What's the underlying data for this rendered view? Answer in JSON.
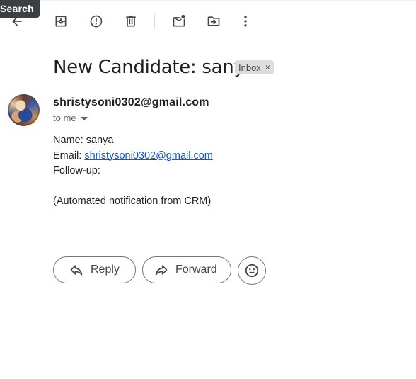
{
  "tooltip": {
    "text": "Search"
  },
  "toolbar": {
    "back_icon": "arrow-left-icon",
    "archive_icon": "archive-icon",
    "spam_icon": "report-spam-icon",
    "delete_icon": "trash-icon",
    "mark_unread_icon": "mark-unread-icon",
    "move_icon": "move-to-folder-icon",
    "more_icon": "more-vert-icon"
  },
  "email": {
    "subject": "New Candidate: sanya",
    "label": "Inbox",
    "label_close": "×",
    "sender": "shristysoni0302@gmail.com",
    "recipient": "to me",
    "body": {
      "name_line": "Name: sanya",
      "email_prefix": "Email: ",
      "email_link": "shristysoni0302@gmail.com",
      "followup_line": "Follow-up:",
      "blank_line": "",
      "footer_line": "(Automated notification from CRM)"
    }
  },
  "actions": {
    "reply_label": "Reply",
    "forward_label": "Forward",
    "emoji_icon": "smiley-icon"
  },
  "colors": {
    "link": "#1155cc",
    "tooltip_bg": "#3c4043",
    "chip_bg": "#dddddd"
  }
}
